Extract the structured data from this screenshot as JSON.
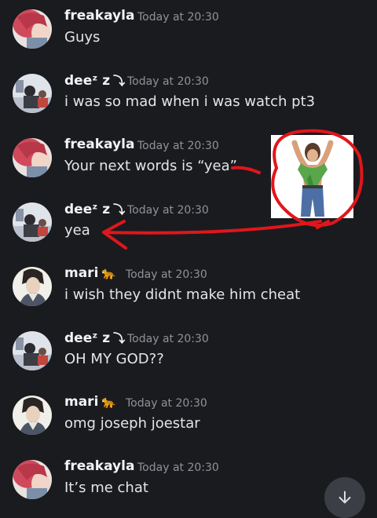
{
  "messages": [
    {
      "author": "freakayla",
      "author_decor": "",
      "timestamp": "Today at 20:30",
      "text": "Guys",
      "avatar": "freakayla-avatar"
    },
    {
      "author": "deeᶻ z",
      "author_decor": "⤵︎",
      "timestamp": "Today at 20:30",
      "text": "i was so mad when i was watch pt3",
      "avatar": "deez-avatar"
    },
    {
      "author": "freakayla",
      "author_decor": "",
      "timestamp": "Today at 20:30",
      "text": "Your next words is “yea”",
      "avatar": "freakayla-avatar"
    },
    {
      "author": "deeᶻ z",
      "author_decor": "⤵︎",
      "timestamp": "Today at 20:30",
      "text": "yea",
      "avatar": "deez-avatar"
    },
    {
      "author": "mari",
      "author_decor": "🐆",
      "timestamp": "Today at 20:30",
      "text": "i wish they didnt make him cheat",
      "avatar": "mari-avatar"
    },
    {
      "author": "deeᶻ z",
      "author_decor": "⤵︎",
      "timestamp": "Today at 20:30",
      "text": "OH MY GOD??",
      "avatar": "deez-avatar"
    },
    {
      "author": "mari",
      "author_decor": "🐆",
      "timestamp": "Today at 20:30",
      "text": "omg joseph joestar",
      "avatar": "mari-avatar"
    },
    {
      "author": "freakayla",
      "author_decor": "",
      "timestamp": "Today at 20:30",
      "text": "It’s me chat",
      "avatar": "freakayla-avatar"
    }
  ],
  "scroll_button": {
    "icon": "arrow-down-icon"
  },
  "colors": {
    "background": "#1a1b1f",
    "username": "#f2f3f5",
    "timestamp": "#8e9297",
    "message_text": "#e3e5e8",
    "annotation_red": "#e0161b"
  }
}
